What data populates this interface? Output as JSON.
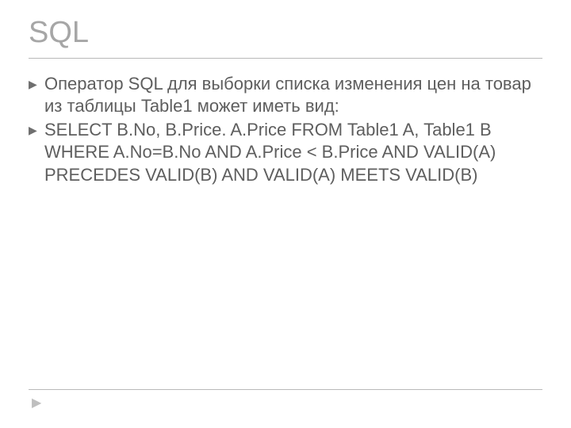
{
  "title": "SQL",
  "bullets": [
    "Оператор SQL для выборки списка изменения цен на товар из таблицы Table1 может иметь вид:",
    "SELECT B.No, B.Price. A.Price FROM Table1 A, Table1 B WHERE A.No=B.No AND A.Price < B.Price AND VALID(A) PRECEDES VALID(B) AND VALID(A) MEETS VALID(B)"
  ]
}
